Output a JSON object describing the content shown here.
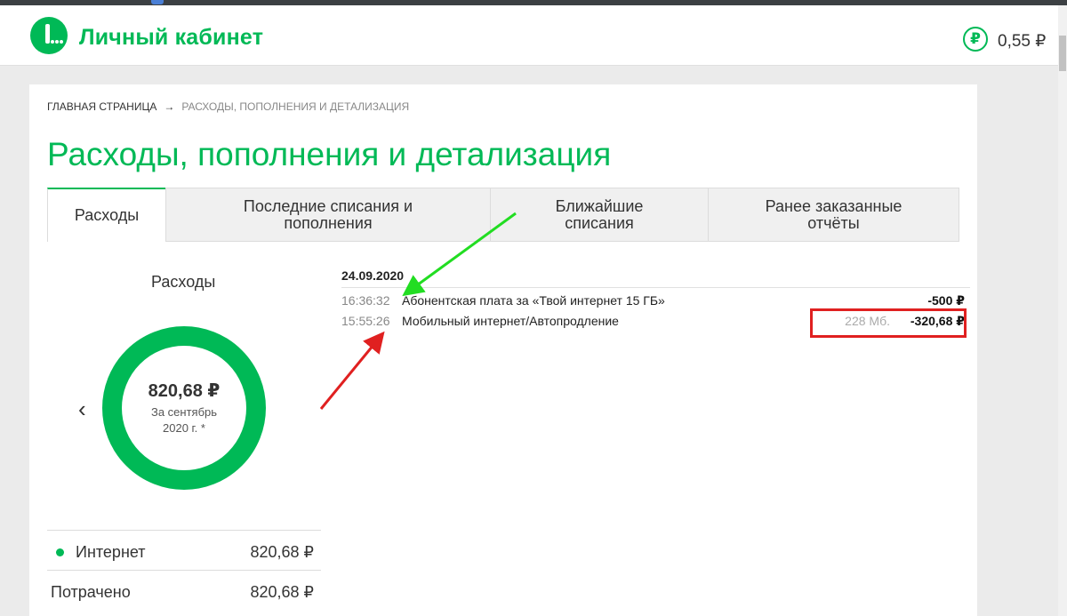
{
  "header": {
    "title": "Личный кабинет",
    "balance": "0,55 ₽",
    "balance_icon": "ruble-icon"
  },
  "breadcrumb": {
    "home": "Главная страница",
    "separator": "→",
    "current": "Расходы, пополнения и детализация"
  },
  "page_title": "Расходы, пополнения и детализация",
  "tabs": [
    {
      "label_1": "Расходы",
      "label_2": ""
    },
    {
      "label_1": "Последние списания и",
      "label_2": "пополнения"
    },
    {
      "label_1": "Ближайшие",
      "label_2": "списания"
    },
    {
      "label_1": "Ранее заказанные",
      "label_2": "отчёты"
    }
  ],
  "expenses": {
    "title": "Расходы",
    "nav_prev": "‹",
    "total": "820,68 ₽",
    "period_1": "За сентябрь",
    "period_2": "2020 г. *",
    "summary": [
      {
        "label": "Интернет",
        "value": "820,68 ₽"
      },
      {
        "label": "Потрачено",
        "value": "820,68 ₽"
      }
    ]
  },
  "details": {
    "date": "24.09.2020",
    "transactions": [
      {
        "time": "16:36:32",
        "description": "Абонентская плата за «Твой интернет 15 ГБ»",
        "volume": "",
        "amount": "-500 ₽"
      },
      {
        "time": "15:55:26",
        "description": "Мобильный интернет/Автопродление",
        "volume": "228 Мб.",
        "amount": "-320,68 ₽"
      }
    ]
  },
  "colors": {
    "brand_green": "#00b956",
    "annotation_green": "#22dd22",
    "annotation_red": "#e02020"
  }
}
